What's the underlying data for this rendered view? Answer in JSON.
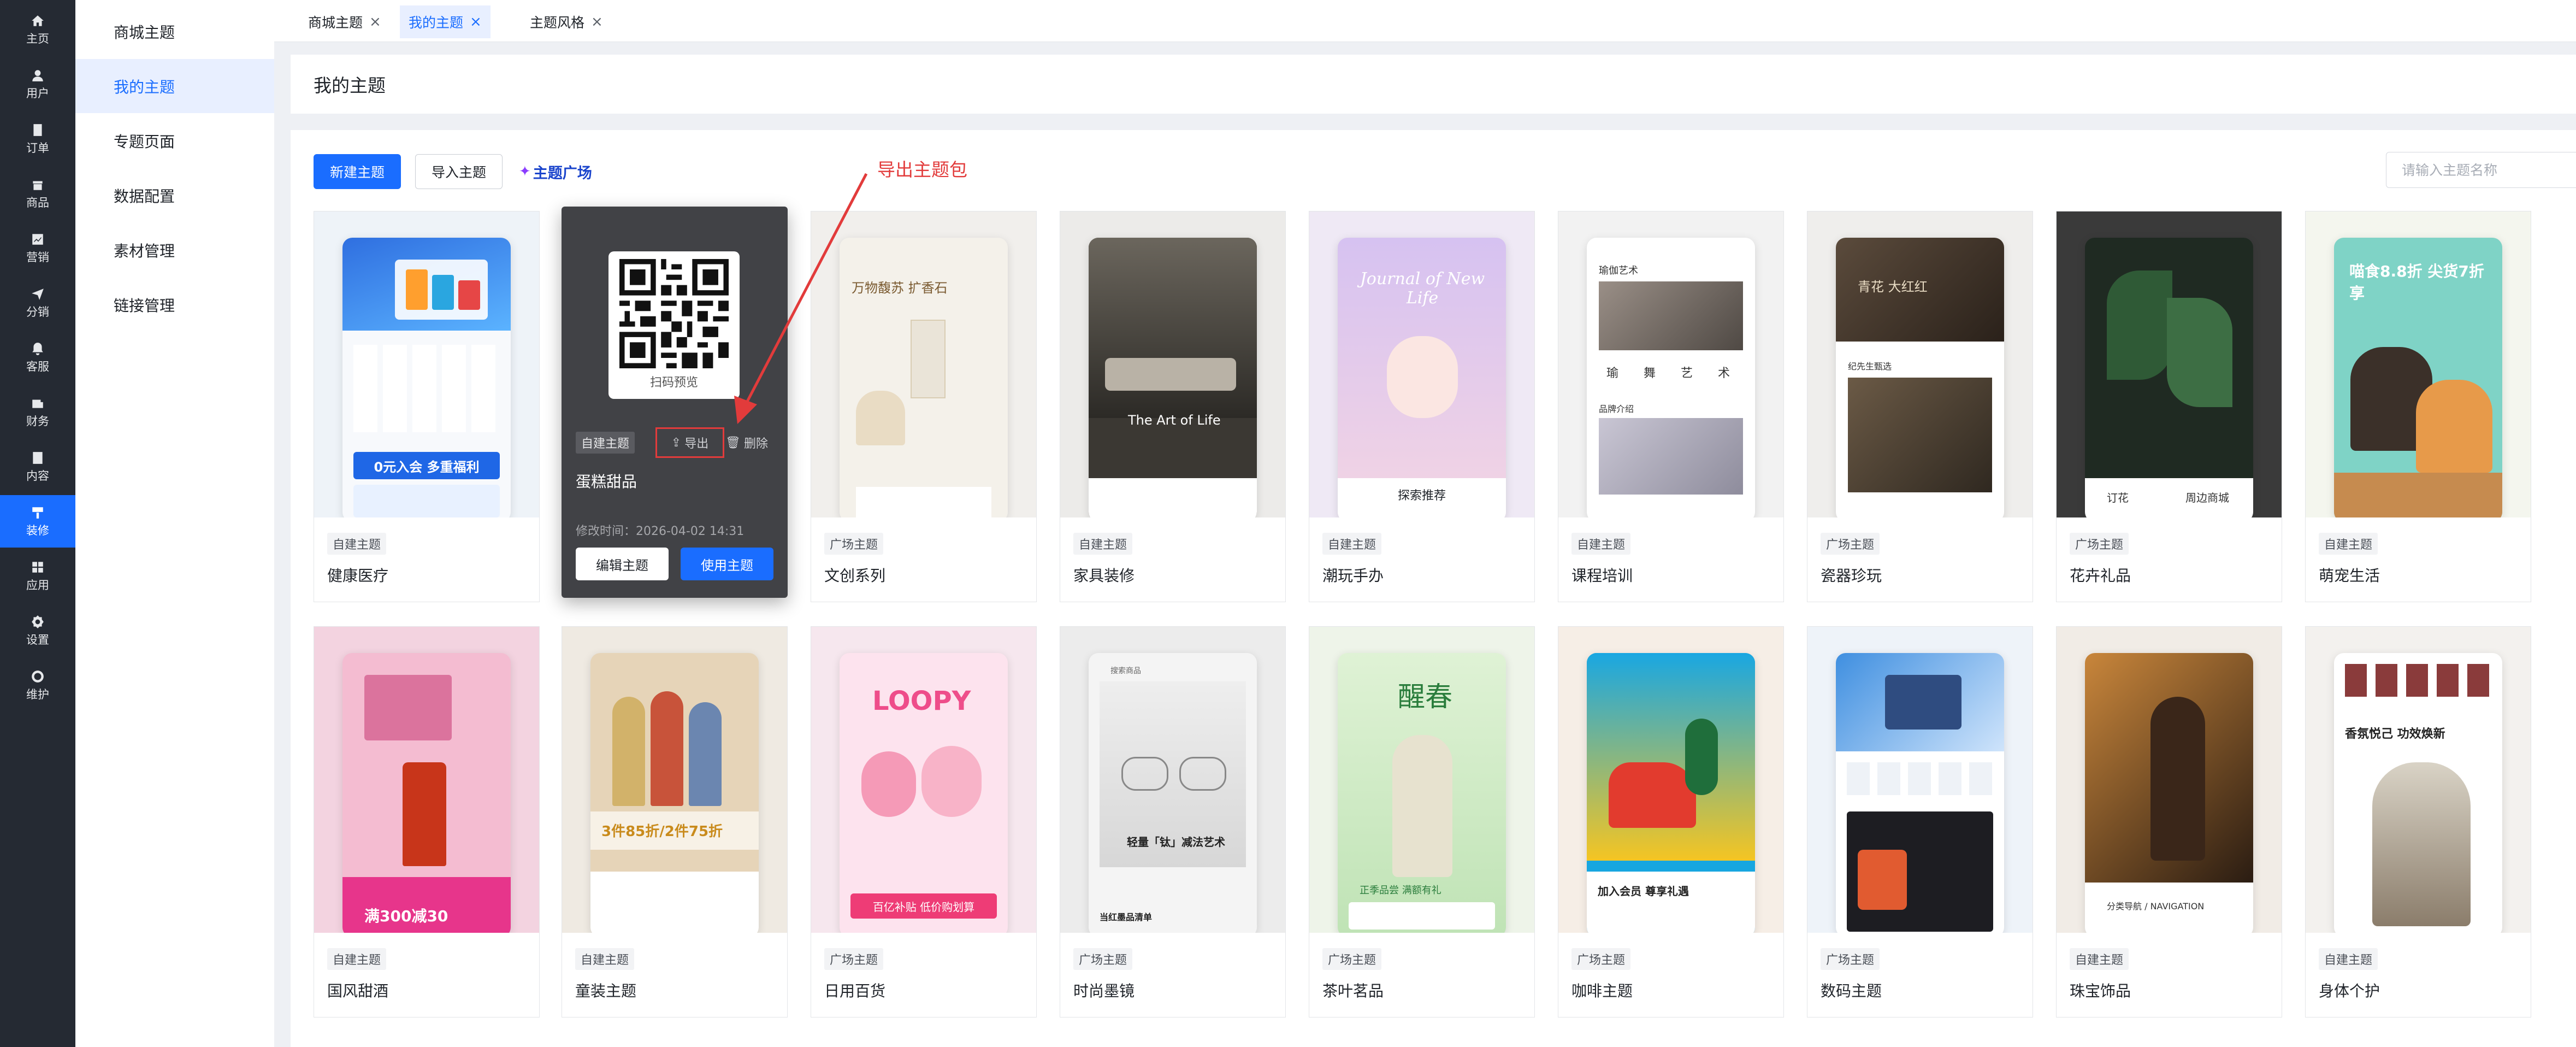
{
  "rail": {
    "items": [
      {
        "label": "主页",
        "icon": "home-icon"
      },
      {
        "label": "用户",
        "icon": "user-icon"
      },
      {
        "label": "订单",
        "icon": "order-icon"
      },
      {
        "label": "商品",
        "icon": "goods-icon"
      },
      {
        "label": "营销",
        "icon": "marketing-icon"
      },
      {
        "label": "分销",
        "icon": "distribution-icon"
      },
      {
        "label": "客服",
        "icon": "service-bell-icon"
      },
      {
        "label": "财务",
        "icon": "finance-icon"
      },
      {
        "label": "内容",
        "icon": "content-icon"
      },
      {
        "label": "装修",
        "icon": "decoration-icon",
        "active": true
      },
      {
        "label": "应用",
        "icon": "apps-grid-icon"
      },
      {
        "label": "设置",
        "icon": "settings-gear-icon"
      },
      {
        "label": "维护",
        "icon": "maintenance-icon"
      }
    ],
    "active_color": "#1a6dff"
  },
  "submenu": {
    "items": [
      {
        "label": "商城主题"
      },
      {
        "label": "我的主题",
        "active": true
      },
      {
        "label": "专题页面"
      },
      {
        "label": "数据配置"
      },
      {
        "label": "素材管理"
      },
      {
        "label": "链接管理"
      }
    ]
  },
  "tabs": [
    {
      "label": "商城主题"
    },
    {
      "label": "我的主题",
      "active": true
    },
    {
      "label": "主题风格"
    }
  ],
  "page": {
    "title": "我的主题"
  },
  "toolbar": {
    "new_label": "新建主题",
    "import_label": "导入主题",
    "plaza_label": "主题广场",
    "search_placeholder": "请输入主题名称"
  },
  "annotation": {
    "text": "导出主题包",
    "color": "#e23b3b"
  },
  "hover_card": {
    "qr_caption": "扫码预览",
    "badge": "自建主题",
    "export_label": "导出",
    "delete_label": "删除",
    "name": "蛋糕甜品",
    "time": "修改时间：2026-04-02 14:31",
    "edit_label": "编辑主题",
    "use_label": "使用主题"
  },
  "cards_row1": [
    {
      "badge": "自建主题",
      "name": "健康医疗",
      "banner": "0元入会 多重福利"
    },
    {
      "badge": "自建主题",
      "name": "蛋糕甜品"
    },
    {
      "badge": "广场主题",
      "name": "文创系列",
      "banner": "万物馥苏 扩香石"
    },
    {
      "badge": "自建主题",
      "name": "家具装修",
      "banner": "The Art of Life"
    },
    {
      "badge": "自建主题",
      "name": "潮玩手办",
      "banner": "Journal of New Life",
      "sub": "探索推荐"
    },
    {
      "badge": "自建主题",
      "name": "课程培训",
      "banner": "瑜伽艺术",
      "sub": "品牌介绍",
      "chips": [
        "瑜",
        "舞",
        "艺",
        "术"
      ]
    },
    {
      "badge": "广场主题",
      "name": "瓷器珍玩",
      "banner": "青花 大红红",
      "sub": "纪先生甄选"
    },
    {
      "badge": "广场主题",
      "name": "花卉礼品",
      "sub": "订花",
      "sub2": "周边商城"
    },
    {
      "badge": "自建主题",
      "name": "萌宠生活",
      "banner": "喵食8.8折 尖货7折享"
    }
  ],
  "cards_row2": [
    {
      "badge": "自建主题",
      "name": "国风甜酒",
      "banner": "满300减30"
    },
    {
      "badge": "自建主题",
      "name": "童装主题",
      "banner": "3件85折/2件75折"
    },
    {
      "badge": "广场主题",
      "name": "日用百货",
      "banner": "LOOPY",
      "sub": "百亿补贴 低价购划算"
    },
    {
      "badge": "广场主题",
      "name": "时尚墨镜",
      "banner": "轻量「钛」减法艺术",
      "sub": "当红墨品清单",
      "search": "搜索商品"
    },
    {
      "badge": "广场主题",
      "name": "茶叶茗品",
      "banner": "醒春",
      "sub": "正季品尝 满额有礼"
    },
    {
      "badge": "广场主题",
      "name": "咖啡主题",
      "banner": "加入会员 尊享礼遇"
    },
    {
      "badge": "广场主题",
      "name": "数码主题"
    },
    {
      "badge": "自建主题",
      "name": "珠宝饰品",
      "sub": "分类导航 / NAVIGATION"
    },
    {
      "badge": "自建主题",
      "name": "身体个护",
      "banner": "香氛悦己 功效焕新"
    }
  ]
}
